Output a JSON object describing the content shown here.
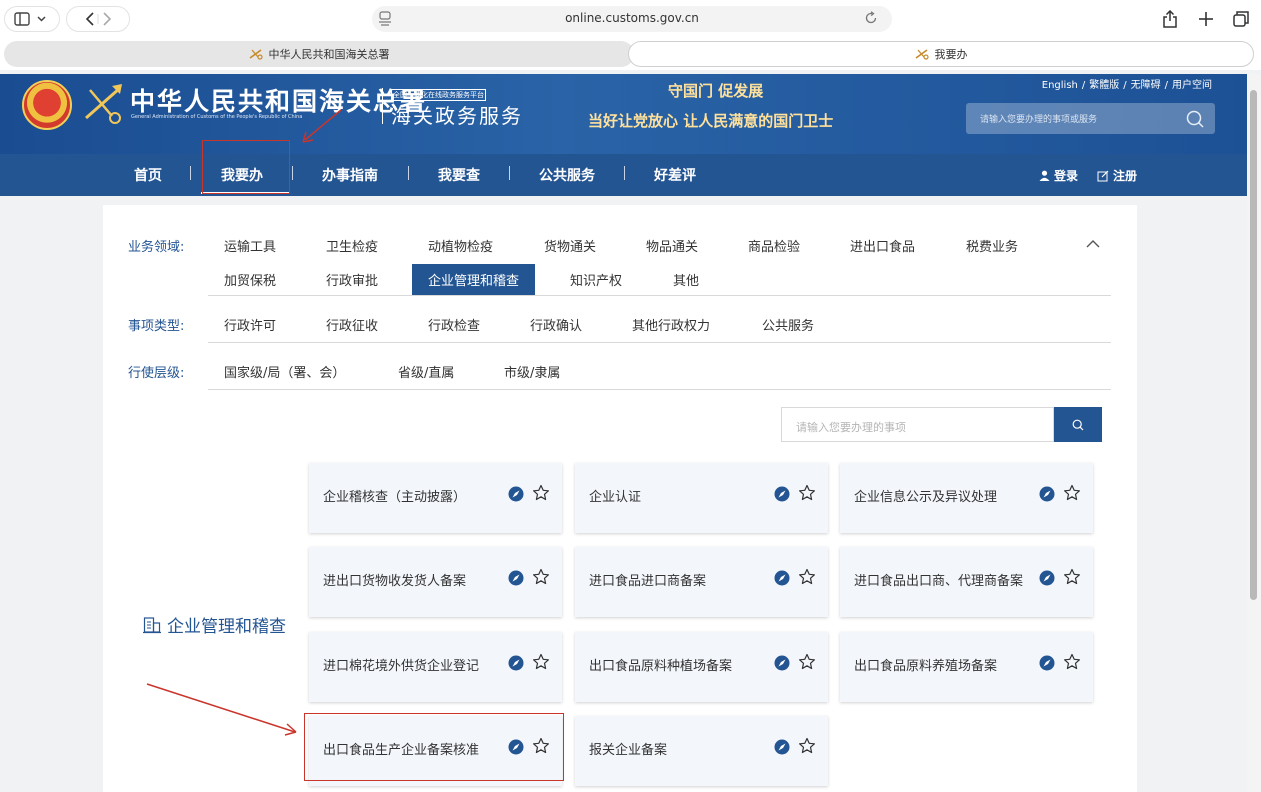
{
  "browser": {
    "url": "online.customs.gov.cn",
    "tabs": [
      {
        "label": "中华人民共和国海关总署",
        "active": false
      },
      {
        "label": "我要办",
        "active": true
      }
    ]
  },
  "header": {
    "logo_cn": "中华人民共和国海关总署",
    "logo_en": "General Administration of Customs of the People's Republic of China",
    "platform_small": "全国一体化在线政务服务平台",
    "platform_big": "海关政务服务",
    "slogan_line1": "守国门  促发展",
    "slogan_line2": "当好让党放心  让人民满意的国门卫士",
    "toplinks": [
      "English",
      "繁體版",
      "无障碍",
      "用户空间"
    ],
    "search_placeholder": "请输入您要办理的事项或服务"
  },
  "nav": {
    "items": [
      "首页",
      "我要办",
      "办事指南",
      "我要查",
      "公共服务",
      "好差评"
    ],
    "active": "我要办",
    "login": "登录",
    "register": "注册"
  },
  "filters": {
    "domain_label": "业务领域:",
    "domain_options": [
      "运输工具",
      "卫生检疫",
      "动植物检疫",
      "货物通关",
      "物品通关",
      "商品检验",
      "进出口食品",
      "税费业务",
      "加贸保税",
      "行政审批",
      "企业管理和稽查",
      "知识产权",
      "其他"
    ],
    "domain_selected": "企业管理和稽查",
    "type_label": "事项类型:",
    "type_options": [
      "行政许可",
      "行政征收",
      "行政检查",
      "行政确认",
      "其他行政权力",
      "公共服务"
    ],
    "level_label": "行使层级:",
    "level_options": [
      "国家级/局（署、会）",
      "省级/直属",
      "市级/隶属"
    ]
  },
  "content": {
    "search_placeholder": "请输入您要办理的事项",
    "category_title": "企业管理和稽查",
    "cards": [
      "企业稽核查（主动披露）",
      "企业认证",
      "企业信息公示及异议处理",
      "进出口货物收发货人备案",
      "进口食品进口商备案",
      "进口食品出口商、代理商备案",
      "进口棉花境外供货企业登记",
      "出口食品原料种植场备案",
      "出口食品原料养殖场备案",
      "出口食品生产企业备案核准",
      "报关企业备案"
    ]
  },
  "colors": {
    "brand_blue": "#245593",
    "annotation_red": "#c9352b",
    "slogan_gold": "#ffe19b"
  }
}
